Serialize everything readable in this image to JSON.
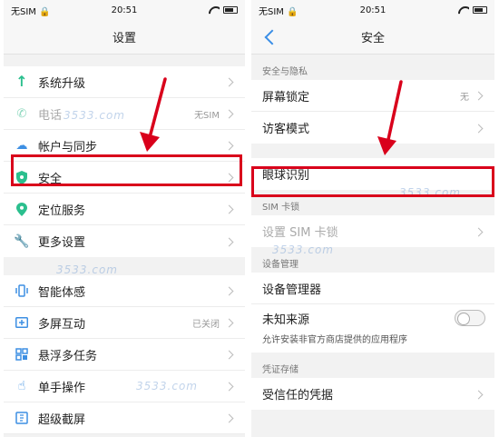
{
  "left": {
    "status": {
      "carrier": "无SIM 🔒",
      "time": "20:51"
    },
    "title": "设置",
    "groups": [
      [
        {
          "label": "系统升级",
          "icon": "arrow-up-icon",
          "color": "#2bbf8e"
        },
        {
          "label": "电话",
          "icon": "phone-icon",
          "color": "#2bbf8e",
          "value": "无SIM",
          "dim": true
        },
        {
          "label": "帐户与同步",
          "icon": "cloud-icon",
          "color": "#3d8fe3"
        },
        {
          "label": "安全",
          "icon": "shield-icon",
          "color": "#2bbf8e"
        },
        {
          "label": "定位服务",
          "icon": "location-icon",
          "color": "#2bbf8e"
        },
        {
          "label": "更多设置",
          "icon": "wrench-icon",
          "color": "#3d8fe3"
        }
      ],
      [
        {
          "label": "智能体感",
          "icon": "gesture-icon",
          "color": "#3d8fe3"
        },
        {
          "label": "多屏互动",
          "icon": "multiscreen-icon",
          "color": "#3d8fe3",
          "value": "已关闭"
        },
        {
          "label": "悬浮多任务",
          "icon": "multitask-icon",
          "color": "#3d8fe3"
        },
        {
          "label": "单手操作",
          "icon": "hand-icon",
          "color": "#3d8fe3"
        },
        {
          "label": "超级截屏",
          "icon": "screenshot-icon",
          "color": "#3d8fe3"
        }
      ]
    ]
  },
  "right": {
    "status": {
      "carrier": "无SIM 🔒",
      "time": "20:51"
    },
    "title": "安全",
    "sections": {
      "privacy": "安全与隐私",
      "sim_lock": "SIM 卡锁",
      "device_admin": "设备管理",
      "credentials": "凭证存储"
    },
    "rows": {
      "screen_lock": {
        "label": "屏幕锁定",
        "value": "无"
      },
      "guest_mode": {
        "label": "访客模式"
      },
      "eye_print": {
        "label": "眼球识别"
      },
      "sim_lock": {
        "label": "设置 SIM 卡锁"
      },
      "device_admins": {
        "label": "设备管理器"
      },
      "unknown_sources": {
        "label": "未知来源",
        "note": "允许安装非官方商店提供的应用程序"
      },
      "trusted_creds": {
        "label": "受信任的凭据"
      }
    }
  },
  "watermark": "3533.com",
  "colors": {
    "highlight": "#d9001b",
    "accent": "#3a8ee6"
  }
}
